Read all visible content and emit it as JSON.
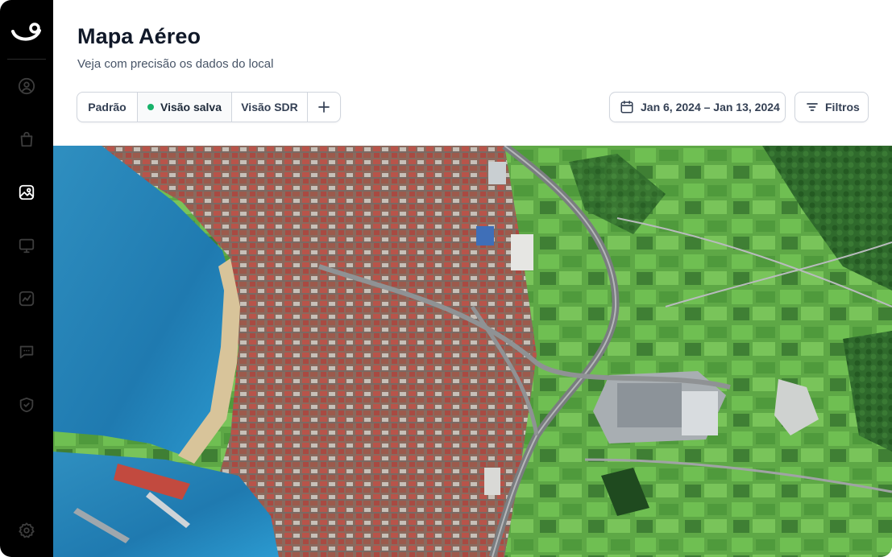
{
  "page": {
    "title": "Mapa Aéreo",
    "subtitle": "Veja com precisão os dados do local"
  },
  "tabs": [
    {
      "label": "Padrão",
      "active": false
    },
    {
      "label": "Visão salva",
      "active": true,
      "status_color": "#17b26a"
    },
    {
      "label": "Visão SDR",
      "active": false
    }
  ],
  "add_tab_icon": "plus-icon",
  "date_range": {
    "label": "Jan 6, 2024 – Jan 13, 2024",
    "icon": "calendar-icon"
  },
  "filters": {
    "label": "Filtros",
    "icon": "filter-lines-icon"
  },
  "sidebar": {
    "logo": "smile-logo",
    "items": [
      {
        "icon": "user-circle-icon",
        "active": false
      },
      {
        "icon": "shopping-bag-icon",
        "active": false
      },
      {
        "icon": "map-image-icon",
        "active": true
      },
      {
        "icon": "monitor-icon",
        "active": false
      },
      {
        "icon": "line-chart-icon",
        "active": false
      },
      {
        "icon": "message-dots-icon",
        "active": false
      },
      {
        "icon": "shield-check-icon",
        "active": false
      }
    ],
    "footer_icon": "settings-icon"
  },
  "map": {
    "image": "aerial-satellite-view"
  },
  "colors": {
    "sidebar_bg": "#000000",
    "icon_inactive": "#3d3d3d",
    "icon_active": "#ffffff",
    "accent_green": "#17b26a"
  }
}
